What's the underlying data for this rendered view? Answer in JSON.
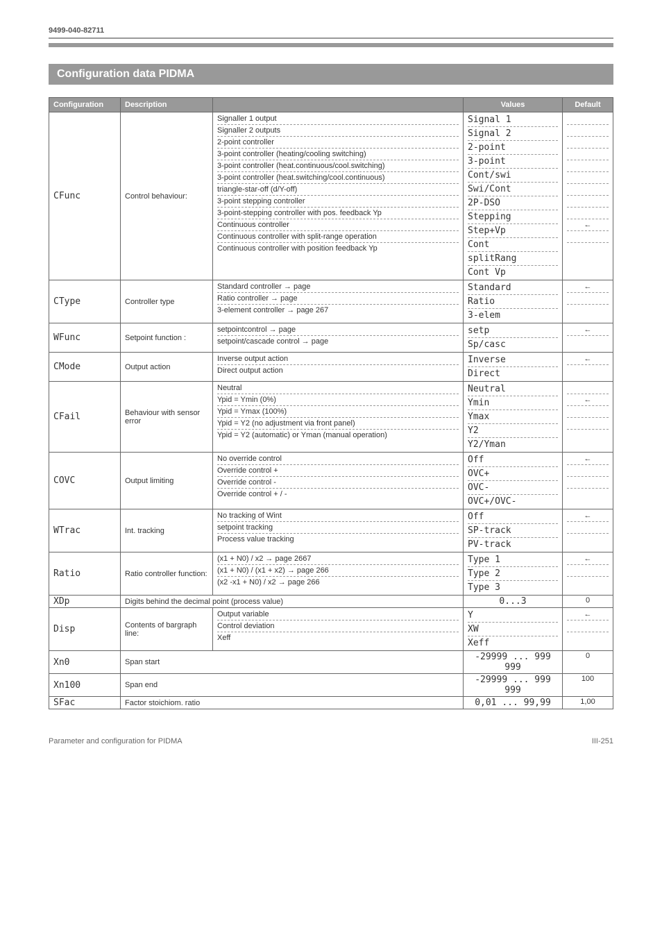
{
  "header_code": "9499-040-82711",
  "section_title": "Configuration data PIDMA",
  "columns": {
    "c1": "Configuration",
    "c2": "Description",
    "c3": "",
    "c4": "Values",
    "c5": "Default"
  },
  "rows": [
    {
      "cfg": "CFunc",
      "desc": "Control behaviour:",
      "subs": [
        {
          "d": "Signaller 1 output",
          "v": "Signal 1",
          "def": ""
        },
        {
          "d": "Signaller 2 outputs",
          "v": "Signal 2",
          "def": ""
        },
        {
          "d": "2-point controller",
          "v": "2-point",
          "def": ""
        },
        {
          "d": "3-point controller (heating/cooling switching)",
          "v": "3-point",
          "def": ""
        },
        {
          "d": "3-point controller (heat.continuous/cool.switching)",
          "v": "Cont/swi",
          "def": ""
        },
        {
          "d": "3-point controller (heat.switching/cool.continuous)",
          "v": "Swi/Cont",
          "def": ""
        },
        {
          "d": "triangle-star-off (d/Y-off)",
          "v": "2P-DSO",
          "def": ""
        },
        {
          "d": "3-point stepping controller",
          "v": "Stepping",
          "def": ""
        },
        {
          "d": "3-point-stepping controller with pos. feedback Yp",
          "v": "Step+Vp",
          "def": ""
        },
        {
          "d": "Continuous controller",
          "v": "Cont",
          "def": "←"
        },
        {
          "d": "Continuous controller with split-range operation",
          "v": "splitRang",
          "def": ""
        },
        {
          "d": "Continuous controller with position feedback Yp",
          "v": "Cont Vp",
          "def": ""
        }
      ]
    },
    {
      "cfg": "CType",
      "desc": "Controller type",
      "subs": [
        {
          "d": "Standard controller →  page",
          "v": "Standard",
          "def": "←"
        },
        {
          "d": "Ratio controller →  page",
          "v": "Ratio",
          "def": ""
        },
        {
          "d": "3-element controller →  page 267",
          "v": "3-elem",
          "def": ""
        }
      ]
    },
    {
      "cfg": "WFunc",
      "desc": "Setpoint function :",
      "subs": [
        {
          "d": "setpointcontrol →  page",
          "v": "setp",
          "def": "←"
        },
        {
          "d": "setpoint/cascade control →  page",
          "v": "Sp/casc",
          "def": ""
        }
      ]
    },
    {
      "cfg": "CMode",
      "desc": "Output action",
      "subs": [
        {
          "d": "Inverse output action",
          "v": "Inverse",
          "def": "←"
        },
        {
          "d": "Direct output action",
          "v": "Direct",
          "def": ""
        }
      ]
    },
    {
      "cfg": "CFail",
      "desc": "Behaviour with sensor error",
      "subs": [
        {
          "d": "Neutral",
          "v": "Neutral",
          "def": ""
        },
        {
          "d": "Ypid = Ymin (0%)",
          "v": "Ymin",
          "def": "←"
        },
        {
          "d": "Ypid = Ymax (100%)",
          "v": "Ymax",
          "def": ""
        },
        {
          "d": "Ypid = Y2 (no adjustment via front panel)",
          "v": "Y2",
          "def": ""
        },
        {
          "d": "Ypid = Y2 (automatic) or Yman (manual operation)",
          "v": "Y2/Yman",
          "def": ""
        }
      ]
    },
    {
      "cfg": "COVC",
      "desc": "Output limiting",
      "subs": [
        {
          "d": "No override control",
          "v": "Off",
          "def": "←"
        },
        {
          "d": "Override control +",
          "v": "OVC+",
          "def": ""
        },
        {
          "d": "Override control -",
          "v": "OVC-",
          "def": ""
        },
        {
          "d": "Override control + / -",
          "v": "OVC+/OVC-",
          "def": ""
        }
      ]
    },
    {
      "cfg": "WTrac",
      "desc": "Int.  tracking",
      "subs": [
        {
          "d": "No tracking of Wint",
          "v": "Off",
          "def": "←"
        },
        {
          "d": "setpoint tracking",
          "v": "SP-track",
          "def": ""
        },
        {
          "d": "Process value tracking",
          "v": "PV-track",
          "def": ""
        }
      ]
    },
    {
      "cfg": "Ratio",
      "desc": "Ratio controller function:",
      "subs": [
        {
          "d": "(x1 + N0) / x2 →  page 2667",
          "v": "Type 1",
          "def": "←"
        },
        {
          "d": "(x1 + N0) / (x1 + x2) →  page 266",
          "v": "Type 2",
          "def": ""
        },
        {
          "d": "(x2 -x1 + N0) / x2 →  page 266",
          "v": "Type 3",
          "def": ""
        }
      ]
    },
    {
      "cfg": "XDp",
      "desc": "Digits behind the decimal point (process value)",
      "single": true,
      "v": "0...3",
      "def": "0"
    },
    {
      "cfg": "Disp",
      "desc": "Contents of bargraph line:",
      "subs": [
        {
          "d": "Output variable",
          "v": "Y",
          "def": "←"
        },
        {
          "d": "Control deviation",
          "v": "XW",
          "def": ""
        },
        {
          "d": "Xeff",
          "v": "Xeff",
          "def": ""
        }
      ]
    },
    {
      "cfg": "Xn0",
      "desc": "Span start",
      "single": true,
      "v": "-29999 ... 999 999",
      "def": "0"
    },
    {
      "cfg": "Xn100",
      "desc": "Span end",
      "single": true,
      "v": "-29999 ... 999 999",
      "def": "100"
    },
    {
      "cfg": "SFac",
      "desc": "Factor stoichiom. ratio",
      "single": true,
      "v": "0,01 ... 99,99",
      "def": "1,00"
    }
  ],
  "footer_left": "Parameter and configuration for PIDMA",
  "footer_right": "III-251"
}
